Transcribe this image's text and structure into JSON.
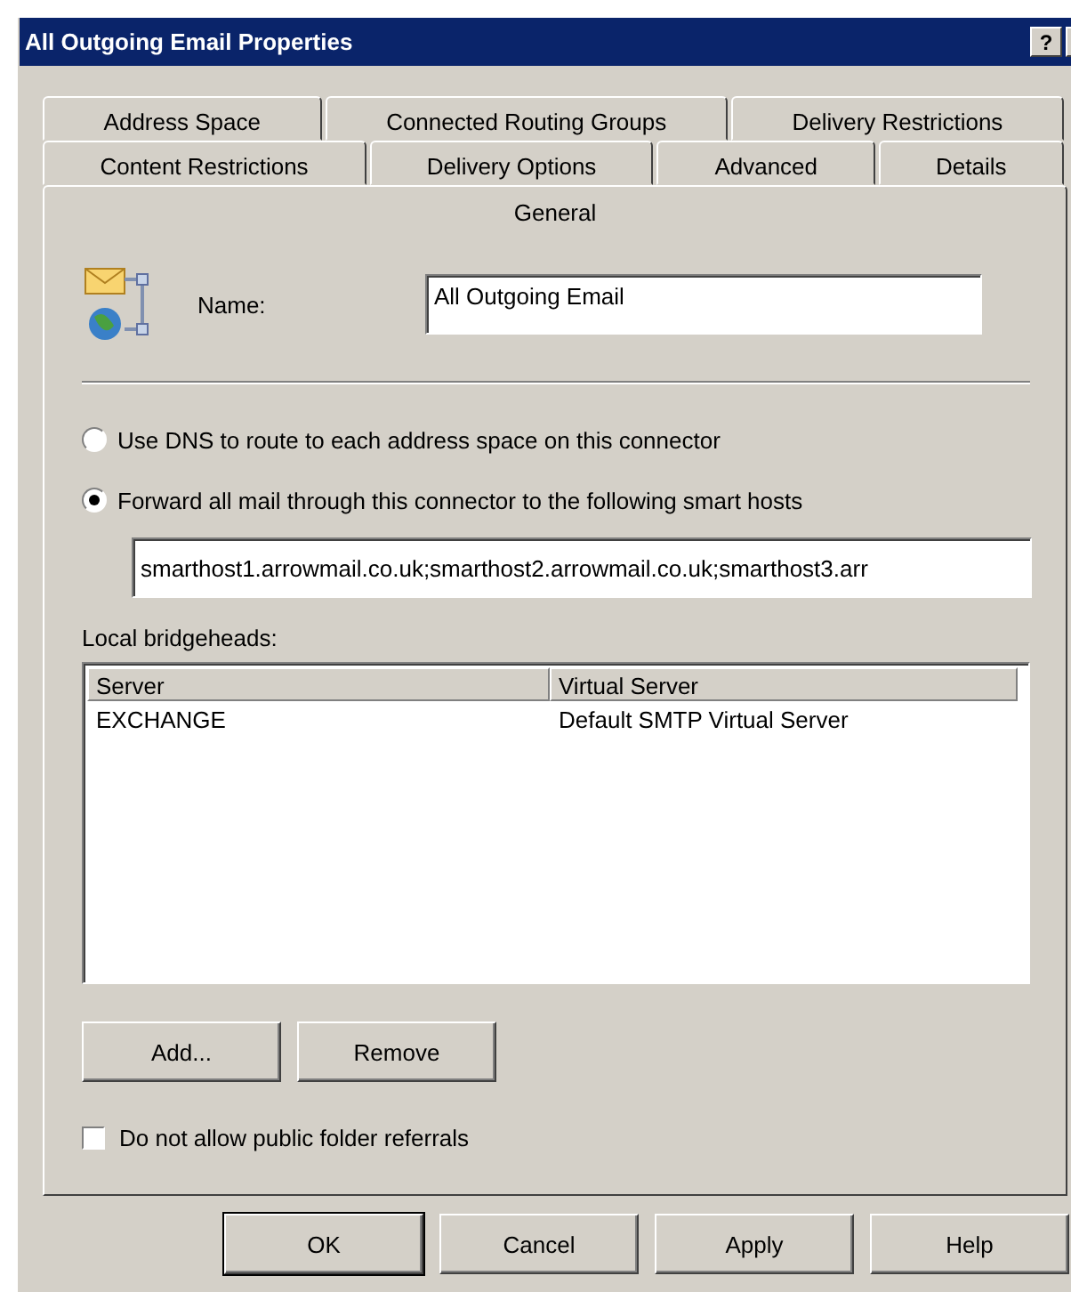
{
  "window": {
    "title": "All Outgoing Email Properties",
    "help_button": "?"
  },
  "tab_rows": [
    {
      "tabs": [
        {
          "label": "Address Space",
          "selected": false
        },
        {
          "label": "Connected Routing Groups",
          "selected": false
        },
        {
          "label": "Delivery Restrictions",
          "selected": false
        }
      ]
    },
    {
      "tabs": [
        {
          "label": "Content Restrictions",
          "selected": false
        },
        {
          "label": "Delivery Options",
          "selected": false
        },
        {
          "label": "Advanced",
          "selected": false
        },
        {
          "label": "Details",
          "selected": false
        }
      ]
    },
    {
      "tabs": [
        {
          "label": "General",
          "selected": true
        }
      ]
    }
  ],
  "name": {
    "label": "Name:",
    "value": "All Outgoing Email"
  },
  "routing_options": [
    {
      "label": "Use DNS to route to each address space on this connector",
      "selected": false
    },
    {
      "label": "Forward all mail through this connector to the following smart hosts",
      "selected": true
    }
  ],
  "smart_hosts": {
    "value": "smarthost1.arrowmail.co.uk;smarthost2.arrowmail.co.uk;smarthost3.arr"
  },
  "bridgeheads": {
    "label": "Local bridgeheads:",
    "columns": [
      "Server",
      "Virtual Server"
    ],
    "rows": [
      [
        "EXCHANGE",
        "Default SMTP Virtual Server"
      ]
    ]
  },
  "list_buttons": [
    "Add...",
    "Remove"
  ],
  "public_folder_referrals": {
    "label": "Do not allow public folder referrals",
    "checked": false
  },
  "buttons": [
    {
      "label": "OK",
      "default": true
    },
    {
      "label": "Cancel",
      "default": false
    },
    {
      "label": "Apply",
      "default": false
    },
    {
      "label": "Help",
      "default": false
    }
  ]
}
